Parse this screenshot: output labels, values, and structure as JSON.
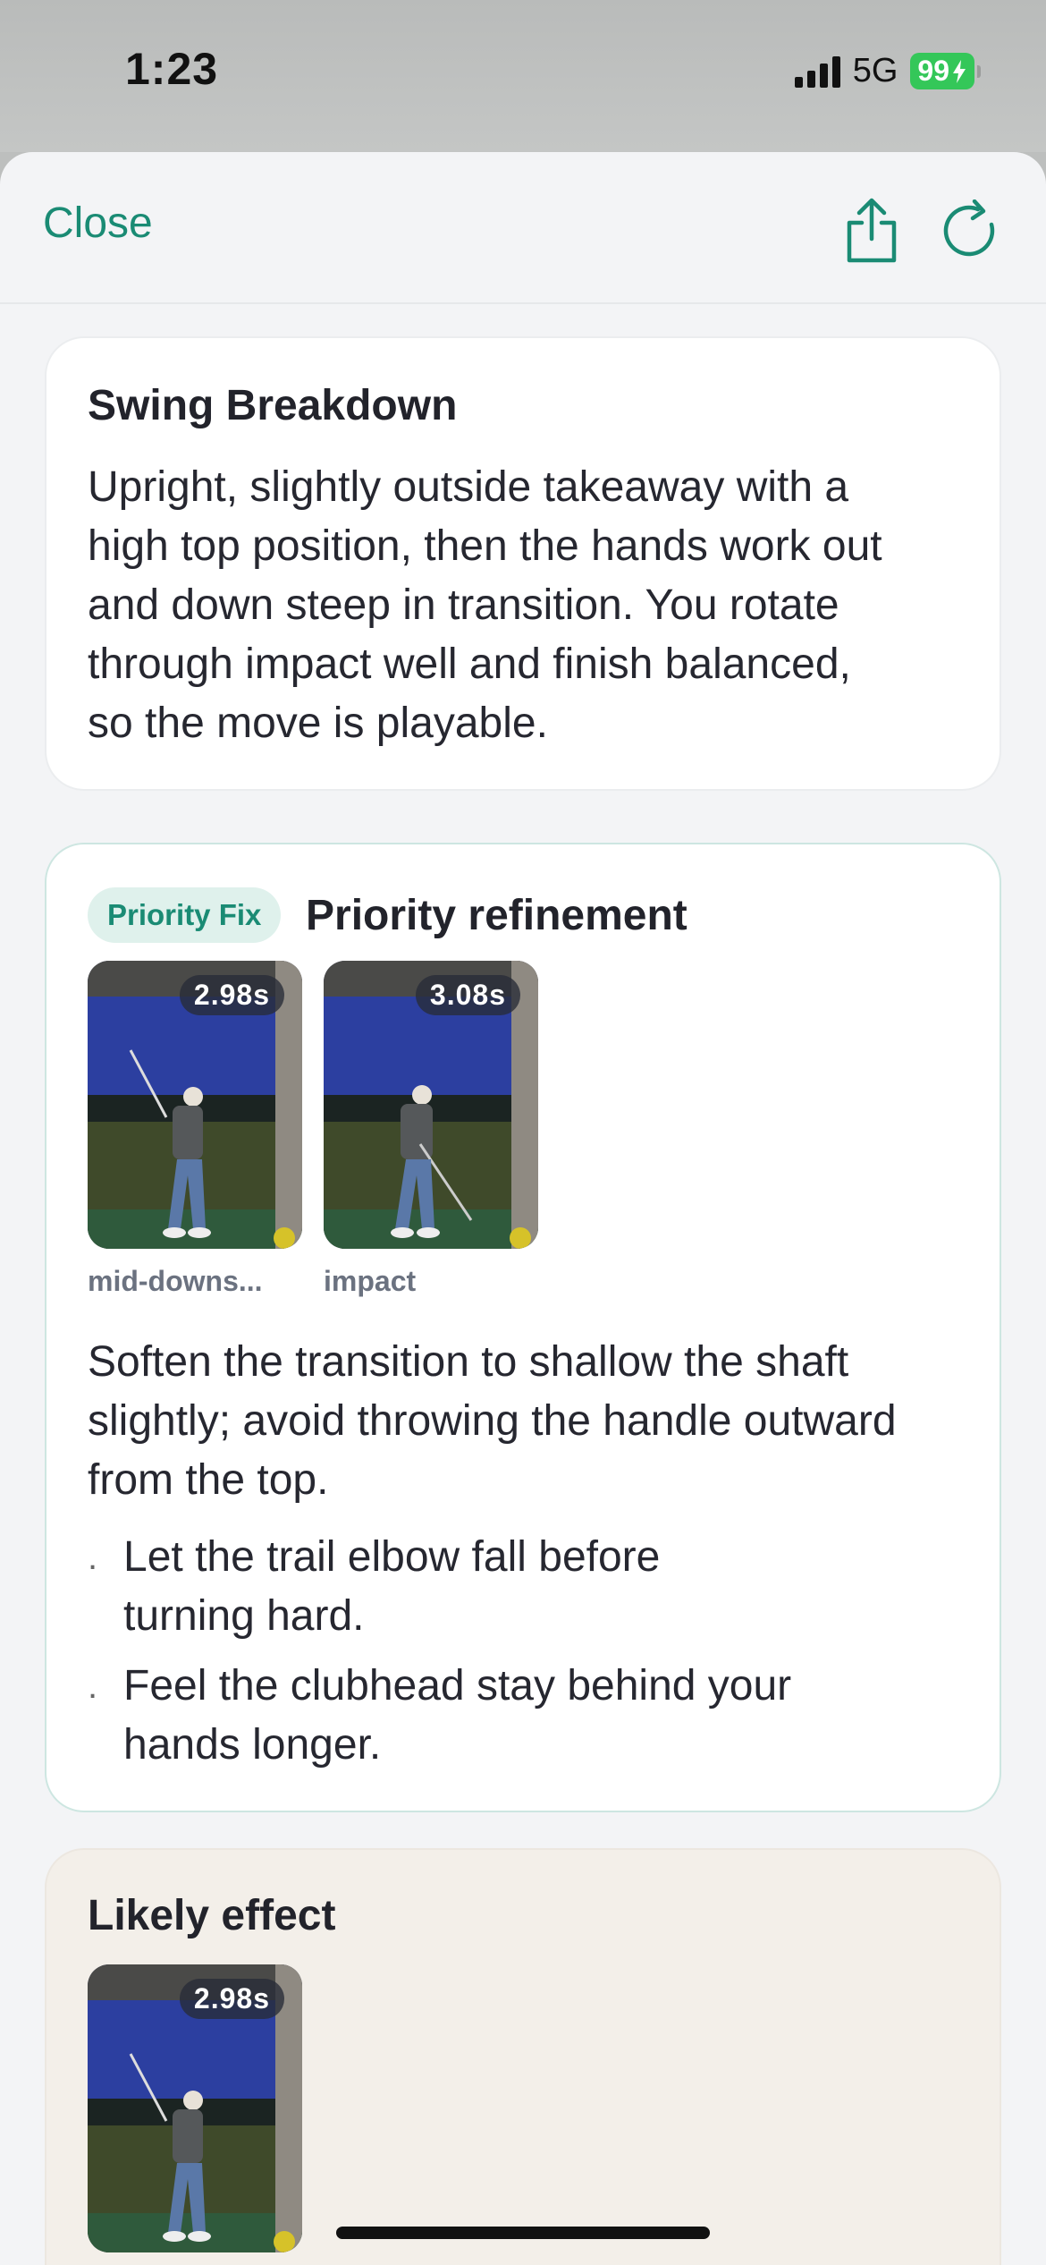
{
  "status_bar": {
    "time": "1:23",
    "network": "5G",
    "battery": "99"
  },
  "nav": {
    "close_label": "Close",
    "icons": [
      "share-icon",
      "refresh-icon"
    ]
  },
  "colors": {
    "accent": "#1a8b74",
    "badge_bg": "#dff1ec",
    "sheet_bg": "#f3f4f6",
    "effect_card_bg": "#f3efe9"
  },
  "breakdown": {
    "title": "Swing Breakdown",
    "lines": [
      "Upright, slightly outside takeaway with a",
      "high top position, then the hands work out",
      "and down steep in transition. You rotate",
      "through impact well and finish balanced,",
      "so the move is playable."
    ]
  },
  "priority": {
    "badge": "Priority Fix",
    "title": "Priority refinement",
    "thumbnails": [
      {
        "timestamp": "2.98s",
        "label": "mid-downs..."
      },
      {
        "timestamp": "3.08s",
        "label": "impact"
      }
    ],
    "lines": [
      "Soften the transition to shallow the shaft",
      "slightly; avoid throwing the handle outward",
      "from the top."
    ],
    "bullets": [
      {
        "dot": ".",
        "lines": [
          "Let the trail elbow fall before",
          "turning hard."
        ]
      },
      {
        "dot": ".",
        "lines": [
          "Feel the clubhead stay behind your",
          "hands longer."
        ]
      }
    ]
  },
  "effect": {
    "title": "Likely effect",
    "thumbnails": [
      {
        "timestamp": "2.98s"
      }
    ]
  }
}
